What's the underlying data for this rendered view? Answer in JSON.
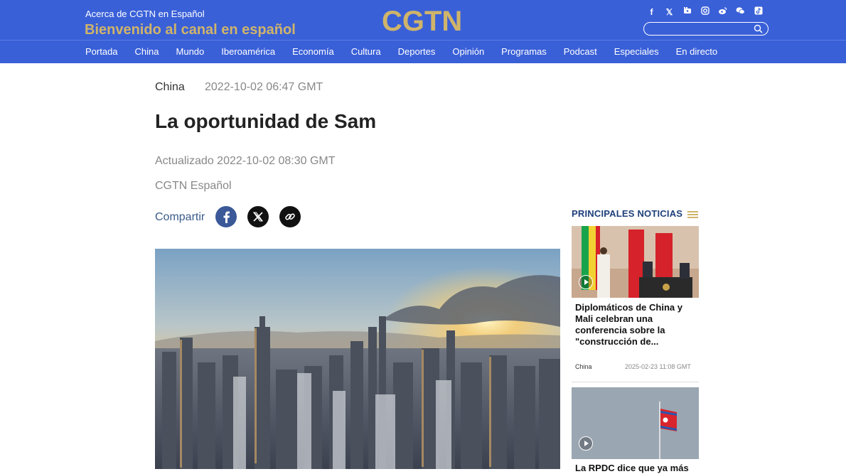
{
  "header": {
    "about": "Acerca de CGTN en Español",
    "welcome": "Bienvenido al canal en español",
    "logo": "CGTN",
    "social_icons": [
      "facebook-icon",
      "x-icon",
      "youtube-icon",
      "instagram-icon",
      "weibo-icon",
      "wechat-icon",
      "tiktok-icon"
    ],
    "search": {
      "placeholder": ""
    }
  },
  "nav": [
    "Portada",
    "China",
    "Mundo",
    "Iberoamérica",
    "Economía",
    "Cultura",
    "Deportes",
    "Opinión",
    "Programas",
    "Podcast",
    "Especiales",
    "En directo"
  ],
  "article": {
    "category": "China",
    "date": "2022-10-02 06:47 GMT",
    "title": "La oportunidad de Sam",
    "updated": "Actualizado 2022-10-02 08:30 GMT",
    "source": "CGTN Español",
    "share_label": "Compartir"
  },
  "sidebar": {
    "title": "PRINCIPALES NOTICIAS",
    "cards": [
      {
        "title": "Diplomáticos de China y Mali celebran una conferencia sobre la \"construcción de...",
        "category": "China",
        "date": "2025-02-23 11:08 GMT"
      },
      {
        "title": "La RPDC dice que ya más"
      }
    ]
  },
  "colors": {
    "header_blue": "#3a60d8",
    "gold": "#cfb46a",
    "sidebar_title": "#1d3f7a"
  }
}
